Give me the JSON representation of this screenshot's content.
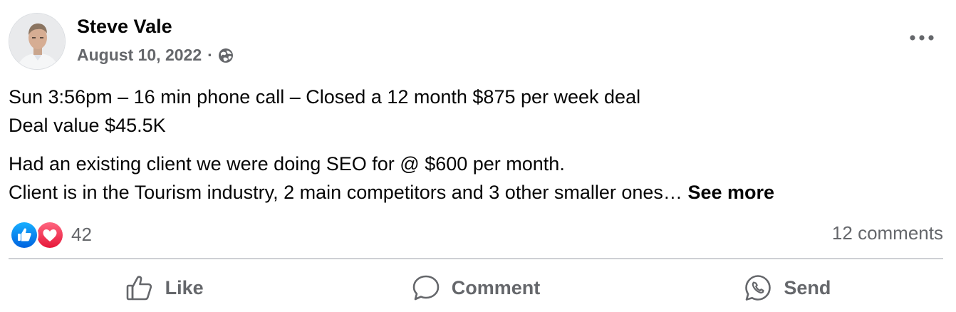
{
  "post": {
    "author": {
      "name": "Steve Vale"
    },
    "date": "August 10, 2022",
    "separator": "·",
    "privacy_icon": "globe-icon",
    "more_icon": "more-options-icon",
    "text_lines": [
      "Sun 3:56pm – 16 min phone call – Closed a 12 month $875 per week deal",
      "Deal value $45.5K",
      "Had an existing client we were doing SEO for @ $600 per month.",
      "Client is in the Tourism industry, 2 main competitors and 3 other smaller ones…"
    ],
    "see_more": "See more"
  },
  "engagement": {
    "reaction_icons": [
      "like-reaction-icon",
      "love-reaction-icon"
    ],
    "reaction_count": "42",
    "comments": "12 comments"
  },
  "actions": {
    "like": "Like",
    "comment": "Comment",
    "send": "Send"
  },
  "colors": {
    "text_primary": "#050505",
    "text_secondary": "#65676b",
    "like_blue": "#1877f2",
    "love_red": "#f33e58",
    "divider": "#ced0d4"
  }
}
